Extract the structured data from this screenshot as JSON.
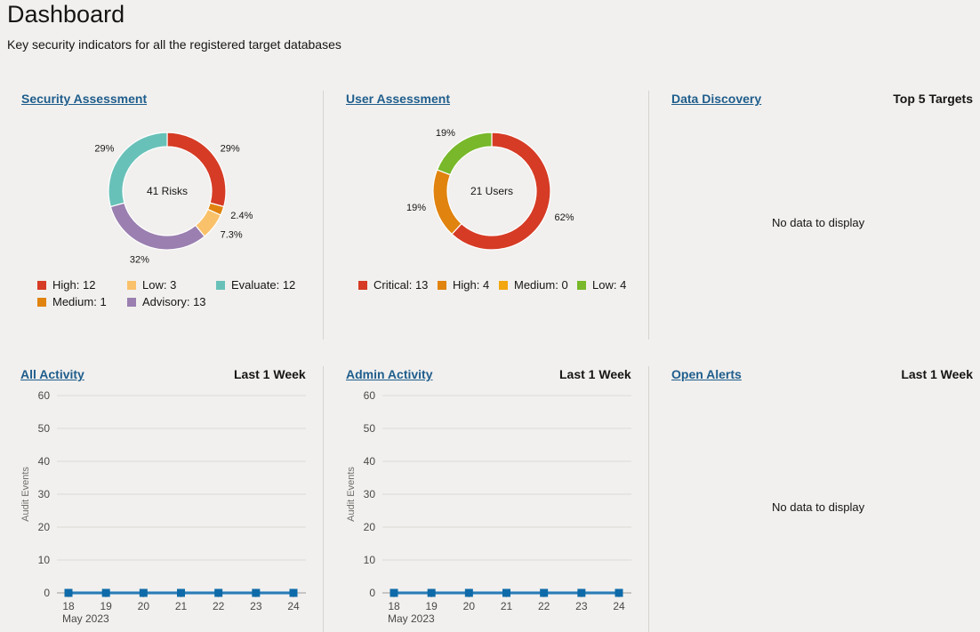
{
  "page": {
    "title": "Dashboard",
    "subtitle": "Key security indicators for all the registered target databases"
  },
  "panels": {
    "security_assessment": {
      "link": "Security Assessment",
      "center_label": "41 Risks",
      "legend": [
        {
          "label": "High: 12",
          "color": "#d63b25"
        },
        {
          "label": "Low: 3",
          "color": "#fac16b"
        },
        {
          "label": "Evaluate: 12",
          "color": "#68c1b9"
        },
        {
          "label": "Medium: 1",
          "color": "#e0830f"
        },
        {
          "label": "Advisory: 13",
          "color": "#9a7fb0"
        }
      ]
    },
    "user_assessment": {
      "link": "User Assessment",
      "center_label": "21 Users",
      "legend": [
        {
          "label": "Critical: 13",
          "color": "#d63b25"
        },
        {
          "label": "High: 4",
          "color": "#e0830f"
        },
        {
          "label": "Medium: 0",
          "color": "#f2a60f"
        },
        {
          "label": "Low: 4",
          "color": "#78b82a"
        }
      ]
    },
    "data_discovery": {
      "link": "Data Discovery",
      "right_label": "Top 5 Targets",
      "nodata": "No data to display"
    },
    "all_activity": {
      "link": "All Activity",
      "right_label": "Last 1 Week"
    },
    "admin_activity": {
      "link": "Admin Activity",
      "right_label": "Last 1 Week"
    },
    "open_alerts": {
      "link": "Open Alerts",
      "right_label": "Last 1 Week",
      "nodata": "No data to display"
    }
  },
  "chart_data": [
    {
      "type": "pie",
      "variant": "donut",
      "center_label": "41 Risks",
      "slices": [
        {
          "name": "High",
          "value": 12,
          "label": "29%",
          "color": "#d63b25"
        },
        {
          "name": "Medium",
          "value": 1,
          "label": "2.4%",
          "color": "#e0830f"
        },
        {
          "name": "Low",
          "value": 3,
          "label": "7.3%",
          "color": "#fac16b"
        },
        {
          "name": "Advisory",
          "value": 13,
          "label": "32%",
          "color": "#9a7fb0"
        },
        {
          "name": "Evaluate",
          "value": 12,
          "label": "29%",
          "color": "#68c1b9"
        }
      ]
    },
    {
      "type": "pie",
      "variant": "donut",
      "center_label": "21 Users",
      "slices": [
        {
          "name": "Critical",
          "value": 13,
          "label": "62%",
          "color": "#d63b25"
        },
        {
          "name": "High",
          "value": 4,
          "label": "19%",
          "color": "#e0830f"
        },
        {
          "name": "Medium",
          "value": 0,
          "label": "",
          "color": "#f2a60f"
        },
        {
          "name": "Low",
          "value": 4,
          "label": "19%",
          "color": "#78b82a"
        }
      ]
    },
    {
      "type": "line",
      "panel": "All Activity",
      "x": [
        18,
        19,
        20,
        21,
        22,
        23,
        24
      ],
      "x_sublabel": "May 2023",
      "ylabel": "Audit Events",
      "ylim": [
        0,
        60
      ],
      "yticks": [
        0,
        10,
        20,
        30,
        40,
        50,
        60
      ],
      "series": [
        {
          "values": [
            0,
            0,
            0,
            0,
            0,
            0,
            0
          ],
          "color": "#0e6aa8"
        }
      ],
      "grid": true
    },
    {
      "type": "line",
      "panel": "Admin Activity",
      "x": [
        18,
        19,
        20,
        21,
        22,
        23,
        24
      ],
      "x_sublabel": "May 2023",
      "ylabel": "Audit Events",
      "ylim": [
        0,
        60
      ],
      "yticks": [
        0,
        10,
        20,
        30,
        40,
        50,
        60
      ],
      "series": [
        {
          "values": [
            0,
            0,
            0,
            0,
            0,
            0,
            0
          ],
          "color": "#0e6aa8"
        }
      ],
      "grid": true
    }
  ]
}
